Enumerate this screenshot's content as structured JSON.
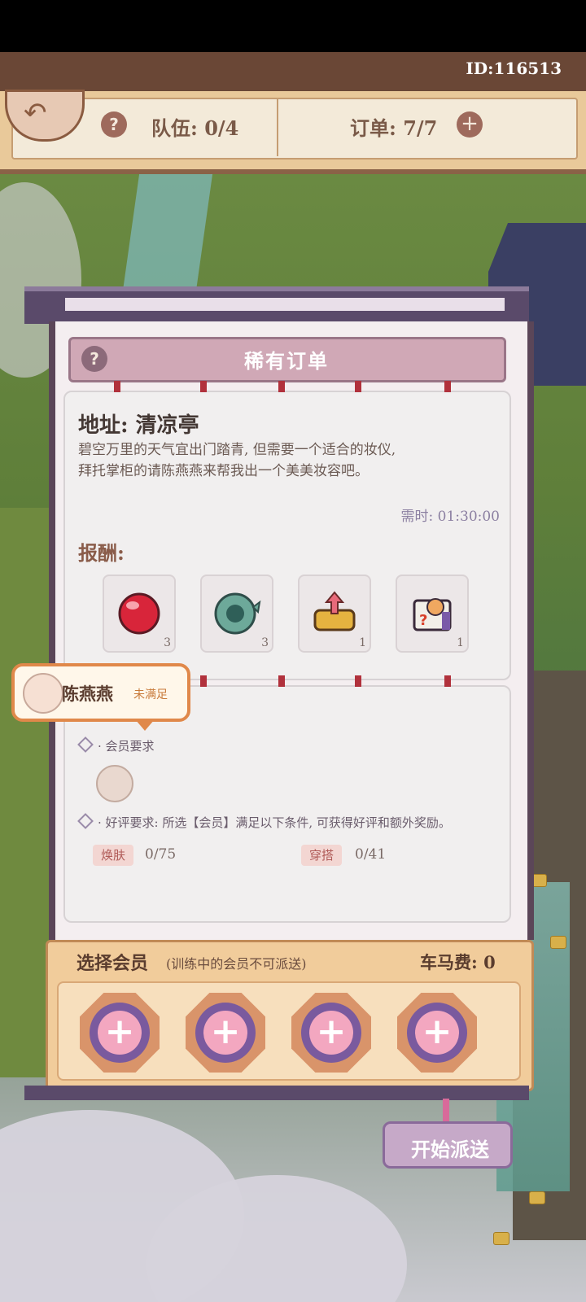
{
  "header": {
    "id_label": "ID:116513",
    "team_label": "队伍: 0/4",
    "order_label": "订单: 7/7"
  },
  "panel": {
    "title": "稀有订单",
    "address": "地址: 清凉亭",
    "description_line1": "碧空万里的天气宜出门踏青, 但需要一个适合的妆仪,",
    "description_line2": "拜托掌柜的请陈燕燕来帮我出一个美美妆容吧。",
    "time_required": "需时: 01:30:00",
    "reward_label": "报酬:",
    "rewards": [
      {
        "icon": "red-orb-icon",
        "count": "3"
      },
      {
        "icon": "green-fish-orb-icon",
        "count": "3"
      },
      {
        "icon": "treasure-chest-icon",
        "count": "1"
      },
      {
        "icon": "mystery-box-icon",
        "count": "1"
      }
    ]
  },
  "member_tip": {
    "name": "陈燕燕",
    "status": "未满足"
  },
  "requirements": {
    "member_req_label": "· 会员要求",
    "review_req_label": "· 好评要求: 所选【会员】满足以下条件, 可获得好评和额外奖励。",
    "stats": [
      {
        "tag": "焕肤",
        "value": "0/75"
      },
      {
        "tag": "穿搭",
        "value": "0/41"
      }
    ]
  },
  "select": {
    "title": "选择会员",
    "subtitle": "(训练中的会员不可派送)",
    "fare": "车马费: 0",
    "slot_symbol": "+"
  },
  "start_button": "开始派送",
  "colors": {
    "panel_title_bg": "#d0a8b6",
    "select_bg": "#f1cc9b",
    "slot_ring": "#7a5a9e",
    "tip_border": "#e0884a"
  }
}
